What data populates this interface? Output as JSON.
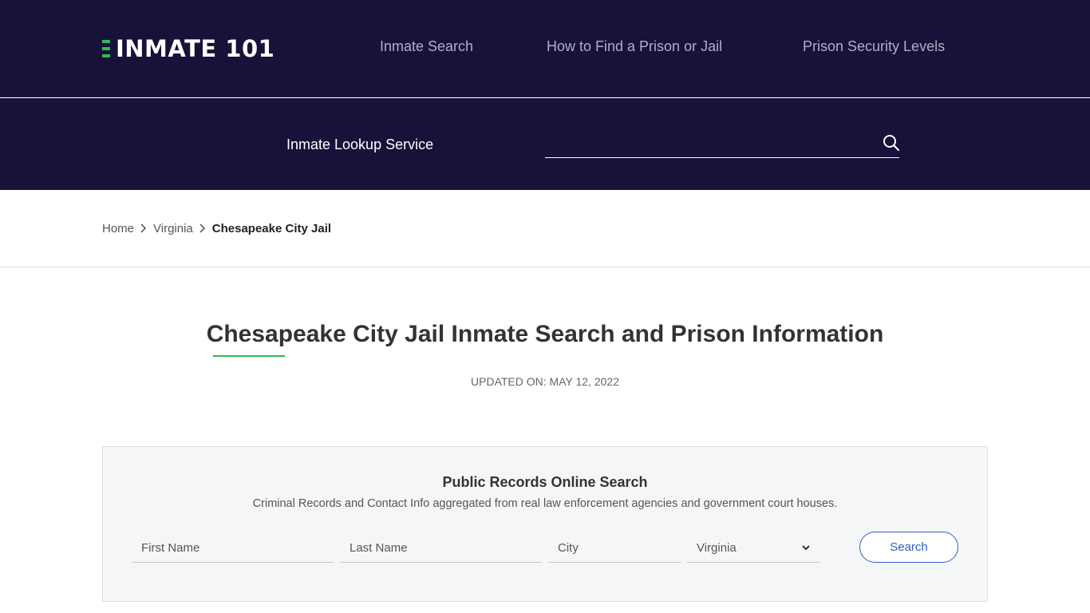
{
  "header": {
    "logo_text": "INMATE 101",
    "nav": [
      {
        "label": "Inmate Search"
      },
      {
        "label": "How to Find a Prison or Jail"
      },
      {
        "label": "Prison Security Levels"
      }
    ]
  },
  "lookup": {
    "label": "Inmate Lookup Service",
    "input_value": "",
    "search_icon": "search-icon"
  },
  "breadcrumb": {
    "home": "Home",
    "state": "Virginia",
    "current": "Chesapeake City Jail",
    "separator_icon": "chevron-right-icon"
  },
  "main": {
    "title": "Chesapeake City Jail Inmate Search and Prison Information",
    "updated": "UPDATED ON: MAY 12, 2022"
  },
  "records": {
    "title": "Public Records Online Search",
    "subtitle": "Criminal Records and Contact Info aggregated from real law enforcement agencies and government court houses.",
    "first_name_placeholder": "First Name",
    "last_name_placeholder": "Last Name",
    "city_placeholder": "City",
    "state_selected": "Virginia",
    "search_label": "Search"
  },
  "colors": {
    "header_bg": "#18113a",
    "accent_green": "#2dbf4e",
    "button_blue": "#2f60c5"
  }
}
